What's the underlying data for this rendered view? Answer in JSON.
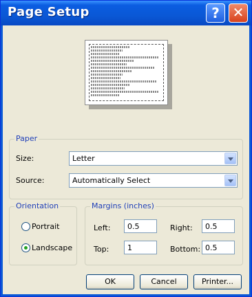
{
  "window": {
    "title": "Page Setup",
    "help_icon": "question-mark-icon",
    "close_icon": "close-icon",
    "colors": {
      "title_bar": "#0a58d6",
      "client": "#ece9d8",
      "group_label": "#1f3fb8",
      "close_button": "#d8421c"
    }
  },
  "paper": {
    "group_label": "Paper",
    "size_label": "Size:",
    "size_value": "Letter",
    "source_label": "Source:",
    "source_value": "Automatically Select"
  },
  "orientation": {
    "group_label": "Orientation",
    "portrait_label": "Portrait",
    "landscape_label": "Landscape",
    "selected": "Landscape"
  },
  "margins": {
    "group_label": "Margins (inches)",
    "left_label": "Left:",
    "left_value": "0.5",
    "right_label": "Right:",
    "right_value": "0.5",
    "top_label": "Top:",
    "top_value": "1",
    "bottom_label": "Bottom:",
    "bottom_value": "0.5"
  },
  "buttons": {
    "ok": "OK",
    "cancel": "Cancel",
    "printer": "Printer..."
  }
}
